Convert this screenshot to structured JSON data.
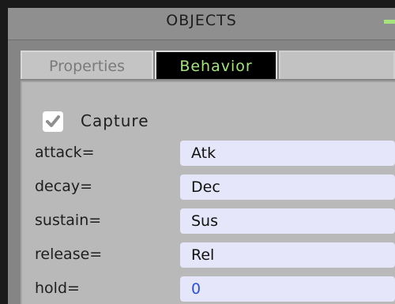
{
  "panel": {
    "title": "OBJECTS",
    "accent_color": "#a6e37d"
  },
  "tabs": [
    {
      "label": "Properties",
      "active": false
    },
    {
      "label": "Behavior",
      "active": true
    }
  ],
  "capture": {
    "label": "Capture",
    "checked": true
  },
  "fields": [
    {
      "label": "attack=",
      "value": "Atk"
    },
    {
      "label": "decay=",
      "value": "Dec"
    },
    {
      "label": "sustain=",
      "value": "Sus"
    },
    {
      "label": "release=",
      "value": "Rel"
    },
    {
      "label": "hold=",
      "value": "0"
    }
  ]
}
